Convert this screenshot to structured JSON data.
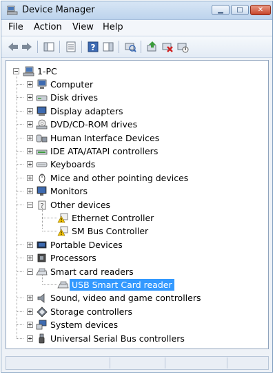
{
  "window": {
    "title": "Device Manager"
  },
  "menu": [
    "File",
    "Action",
    "View",
    "Help"
  ],
  "toolbar": {
    "icons": [
      "back-arrow-icon",
      "forward-arrow-icon",
      "show-hide-console-tree-icon",
      "properties-icon",
      "help-icon",
      "action-pane-icon",
      "scan-hardware-icon",
      "update-driver-icon",
      "uninstall-icon",
      "disable-icon"
    ]
  },
  "tree": {
    "root": "1-PC",
    "categories": [
      {
        "label": "Computer",
        "icon": "computer-icon",
        "expanded": false
      },
      {
        "label": "Disk drives",
        "icon": "disk-drive-icon",
        "expanded": false
      },
      {
        "label": "Display adapters",
        "icon": "display-adapter-icon",
        "expanded": false
      },
      {
        "label": "DVD/CD-ROM drives",
        "icon": "dvd-drive-icon",
        "expanded": false
      },
      {
        "label": "Human Interface Devices",
        "icon": "hid-icon",
        "expanded": false
      },
      {
        "label": "IDE ATA/ATAPI controllers",
        "icon": "ide-controller-icon",
        "expanded": false
      },
      {
        "label": "Keyboards",
        "icon": "keyboard-icon",
        "expanded": false
      },
      {
        "label": "Mice and other pointing devices",
        "icon": "mouse-icon",
        "expanded": false
      },
      {
        "label": "Monitors",
        "icon": "monitor-icon",
        "expanded": false
      },
      {
        "label": "Other devices",
        "icon": "unknown-device-icon",
        "expanded": true,
        "children": [
          {
            "label": "Ethernet Controller",
            "icon": "warning-device-icon"
          },
          {
            "label": "SM Bus Controller",
            "icon": "warning-device-icon"
          }
        ]
      },
      {
        "label": "Portable Devices",
        "icon": "portable-device-icon",
        "expanded": false
      },
      {
        "label": "Processors",
        "icon": "processor-icon",
        "expanded": false
      },
      {
        "label": "Smart card readers",
        "icon": "smart-card-reader-icon",
        "expanded": true,
        "children": [
          {
            "label": "USB Smart Card reader",
            "icon": "smart-card-reader-icon",
            "selected": true
          }
        ]
      },
      {
        "label": "Sound, video and game controllers",
        "icon": "speaker-icon",
        "expanded": false
      },
      {
        "label": "Storage controllers",
        "icon": "storage-controller-icon",
        "expanded": false
      },
      {
        "label": "System devices",
        "icon": "system-device-icon",
        "expanded": false
      },
      {
        "label": "Universal Serial Bus controllers",
        "icon": "usb-icon",
        "expanded": false
      }
    ]
  },
  "colors": {
    "selection": "#3399ff",
    "close_button": "#c7452a",
    "warning": "#f2c200"
  }
}
